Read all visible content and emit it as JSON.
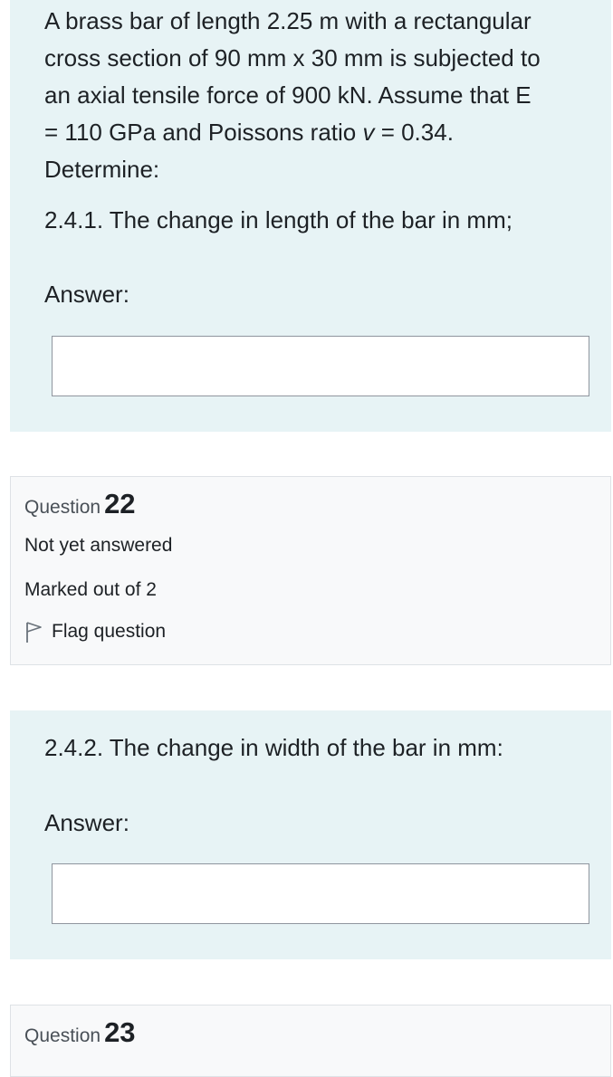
{
  "question21": {
    "problem_lines": [
      "A brass bar of length 2.25 m with a rectangular",
      "cross section of 90 mm x 30 mm is subjected to",
      "an axial tensile force of 900 kN. Assume that E",
      "= 110 GPa and Poissons ratio ",
      "v",
      " = 0.34.",
      "Determine:"
    ],
    "subquestion": "2.4.1. The change in length of the bar in mm;",
    "answer_label": "Answer:",
    "answer_value": ""
  },
  "question22": {
    "word": "Question",
    "number": "22",
    "state": "Not yet answered",
    "grade": "Marked out of 2",
    "flag_label": "Flag question",
    "flag_icon": "flag-outline-icon",
    "subquestion": "2.4.2. The change in width of the bar in mm:",
    "answer_label": "Answer:",
    "answer_value": ""
  },
  "question23": {
    "word": "Question",
    "number": "23"
  }
}
